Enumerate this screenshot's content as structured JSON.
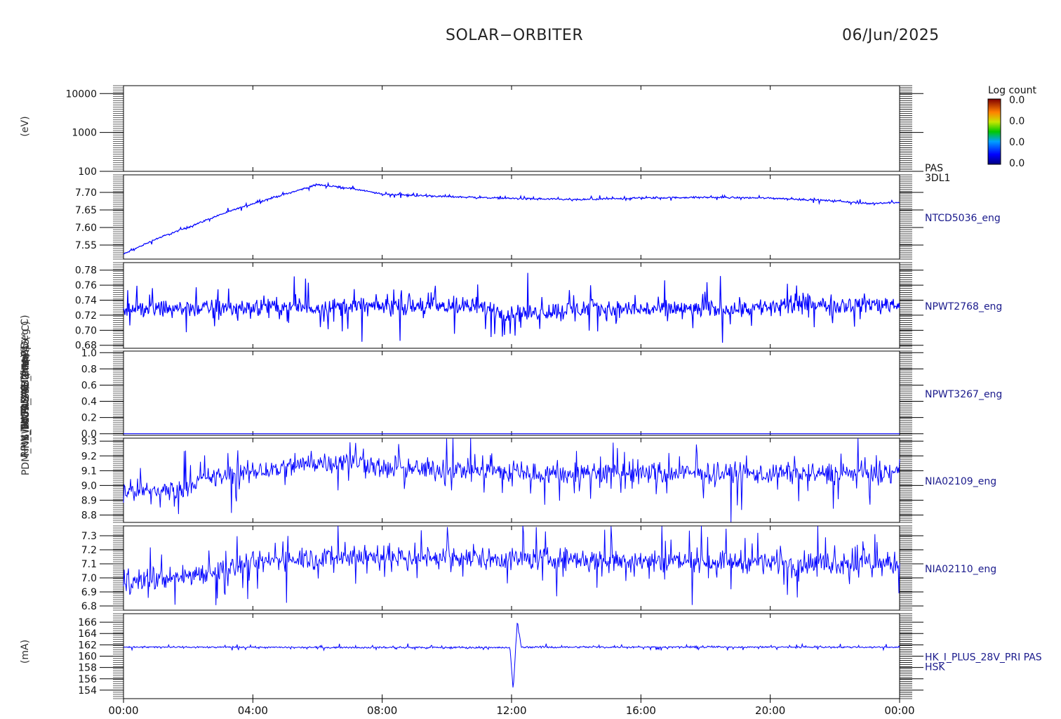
{
  "header": {
    "mission": "SOLAR−ORBITER",
    "date": "06/Jun/2025"
  },
  "colorbar": {
    "title": "Log count",
    "labels": [
      "0.0",
      "0.0",
      "0.0",
      "0.0"
    ]
  },
  "colors": {
    "trace": "#0000ff",
    "axis": "#000000",
    "label_text": "#1a1a8c"
  },
  "chart_data": {
    "type": "line",
    "x_tick_labels": [
      "00:00",
      "04:00",
      "08:00",
      "12:00",
      "16:00",
      "20:00",
      "00:00"
    ],
    "x_range_hours": [
      0,
      24
    ],
    "panels": [
      {
        "id": "pas-3dl1",
        "type": "heatmap",
        "yscale": "log",
        "ylim": [
          100,
          16000
        ],
        "yticks": [
          100,
          1000,
          10000
        ],
        "ytick_labels": [
          "100",
          "1000",
          "10000"
        ],
        "right_label": [
          "PAS",
          "3DL1"
        ],
        "ylabel": "(eV)",
        "values": []
      },
      {
        "id": "ntcd5036",
        "yscale": "linear",
        "ylim": [
          7.51,
          7.75
        ],
        "yticks": [
          7.55,
          7.6,
          7.65,
          7.7
        ],
        "ytick_labels": [
          "7.55",
          "7.60",
          "7.65",
          "7.70"
        ],
        "right_label": [
          "NTCD5036_eng"
        ],
        "ylabel": "(°C)",
        "noise": 0.004,
        "points": [
          [
            0,
            7.524
          ],
          [
            1,
            7.567
          ],
          [
            2,
            7.601
          ],
          [
            3,
            7.637
          ],
          [
            4,
            7.668
          ],
          [
            5,
            7.695
          ],
          [
            6,
            7.722
          ],
          [
            7,
            7.712
          ],
          [
            8,
            7.695
          ],
          [
            10,
            7.688
          ],
          [
            12,
            7.683
          ],
          [
            14,
            7.679
          ],
          [
            16,
            7.684
          ],
          [
            18,
            7.686
          ],
          [
            20,
            7.684
          ],
          [
            22,
            7.676
          ],
          [
            23,
            7.668
          ],
          [
            24,
            7.672
          ]
        ]
      },
      {
        "id": "npwt2768",
        "yscale": "linear",
        "ylim": [
          0.676,
          0.79
        ],
        "yticks": [
          0.68,
          0.7,
          0.72,
          0.74,
          0.76,
          0.78
        ],
        "ytick_labels": [
          "0.68",
          "0.70",
          "0.72",
          "0.74",
          "0.76",
          "0.78"
        ],
        "right_label": [
          "NPWT2768_eng"
        ],
        "ylabel": "SWA-EAS Temp (Deg C)",
        "noise": 0.02,
        "points": [
          [
            0,
            0.728
          ],
          [
            4,
            0.73
          ],
          [
            8,
            0.732
          ],
          [
            11,
            0.731
          ],
          [
            12,
            0.722
          ],
          [
            14,
            0.728
          ],
          [
            18,
            0.728
          ],
          [
            20,
            0.731
          ],
          [
            22,
            0.734
          ],
          [
            24,
            0.735
          ]
        ]
      },
      {
        "id": "npwt3267",
        "yscale": "linear",
        "ylim": [
          -0.02,
          1.02
        ],
        "yticks": [
          0.0,
          0.2,
          0.4,
          0.6,
          0.8,
          1.0
        ],
        "ytick_labels": [
          "0.0",
          "0.2",
          "0.4",
          "0.6",
          "0.8",
          "1.0"
        ],
        "right_label": [
          "NPWT3267_eng"
        ],
        "ylabel": "",
        "noise": 0.0,
        "points": [
          [
            0,
            0.0
          ],
          [
            24,
            0.0
          ]
        ]
      },
      {
        "id": "nia02109",
        "yscale": "linear",
        "ylim": [
          8.75,
          9.32
        ],
        "yticks": [
          8.8,
          8.9,
          9.0,
          9.1,
          9.2,
          9.3
        ],
        "ytick_labels": [
          "8.8",
          "8.9",
          "9.0",
          "9.1",
          "9.2",
          "9.3"
        ],
        "right_label": [
          "NIA02109_eng"
        ],
        "ylabel": "",
        "noise": 0.12,
        "points": [
          [
            0,
            8.96
          ],
          [
            1.8,
            8.97
          ],
          [
            2.0,
            9.02
          ],
          [
            3.0,
            9.06
          ],
          [
            5.0,
            9.12
          ],
          [
            6.0,
            9.16
          ],
          [
            7.5,
            9.16
          ],
          [
            8.0,
            9.11
          ],
          [
            11.0,
            9.11
          ],
          [
            12.0,
            9.08
          ],
          [
            24,
            9.08
          ]
        ]
      },
      {
        "id": "nia02110",
        "yscale": "linear",
        "ylim": [
          6.77,
          7.37
        ],
        "yticks": [
          6.8,
          6.9,
          7.0,
          7.1,
          7.2,
          7.3
        ],
        "ytick_labels": [
          "6.8",
          "6.9",
          "7.0",
          "7.1",
          "7.2",
          "7.3"
        ],
        "right_label": [
          "NIA02110_eng"
        ],
        "ylabel": "",
        "noise": 0.13,
        "points": [
          [
            0,
            6.97
          ],
          [
            1.5,
            7.0
          ],
          [
            2.5,
            7.04
          ],
          [
            3.5,
            7.08
          ],
          [
            5.0,
            7.14
          ],
          [
            7.0,
            7.15
          ],
          [
            12.0,
            7.14
          ],
          [
            24,
            7.1
          ]
        ]
      },
      {
        "id": "hk-i-plus-28v",
        "yscale": "linear",
        "ylim": [
          152.5,
          167.5
        ],
        "yticks": [
          154,
          156,
          158,
          160,
          162,
          164,
          166
        ],
        "ytick_labels": [
          "154",
          "156",
          "158",
          "160",
          "162",
          "164",
          "166"
        ],
        "right_label": [
          "HK_I_PLUS_28V_PRI PAS",
          "HSK"
        ],
        "ylabel": "(mA)",
        "noise": 0.25,
        "points": [
          [
            0,
            161.6
          ],
          [
            11.95,
            161.5
          ],
          [
            12.05,
            154.0
          ],
          [
            12.18,
            166.2
          ],
          [
            12.3,
            161.6
          ],
          [
            24,
            161.6
          ]
        ]
      }
    ],
    "left_axis_titles": [
      "SWA-EAS Temp (Deg C)",
      "SWA-PAS TDC Temp (°C)",
      "Ion Flux (Hz/cm2)",
      "HK_I_PLUS_28V_PRI PAS",
      "RPW_THERMAL (fine)",
      "PDM_HK_IMON_PAS (mA)"
    ]
  }
}
